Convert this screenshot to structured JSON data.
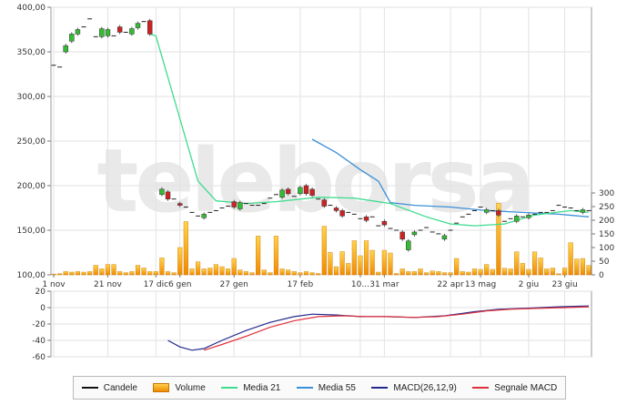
{
  "watermark": "teleborsa",
  "colors": {
    "candle_up": "#33bb33",
    "candle_down": "#cc2222",
    "volume_top": "#ffd24d",
    "volume_bottom": "#f08a00",
    "media21": "#3fdc8e",
    "media55": "#3b8fd6",
    "macd": "#222a8f",
    "signal": "#e0303a"
  },
  "legend": [
    {
      "id": "candele",
      "label": "Candele",
      "color": "#111111",
      "kind": "line"
    },
    {
      "id": "volume",
      "label": "Volume",
      "color": "#f5a100",
      "kind": "box"
    },
    {
      "id": "media21",
      "label": "Media 21",
      "color": "#3fdc8e",
      "kind": "line"
    },
    {
      "id": "media55",
      "label": "Media 55",
      "color": "#3b8fd6",
      "kind": "line"
    },
    {
      "id": "macd",
      "label": "MACD(26,12,9)",
      "color": "#222a8f",
      "kind": "line"
    },
    {
      "id": "signal",
      "label": "Segnale MACD",
      "color": "#e0303a",
      "kind": "line"
    }
  ],
  "chart_data": [
    {
      "type": "candlestick",
      "x_ticks": [
        {
          "i": 0,
          "label": "1 nov"
        },
        {
          "i": 9,
          "label": "21 nov"
        },
        {
          "i": 17,
          "label": "17 dic"
        },
        {
          "i": 21,
          "label": "6 gen"
        },
        {
          "i": 30,
          "label": "27 gen"
        },
        {
          "i": 41,
          "label": "17 feb"
        },
        {
          "i": 51,
          "label": "10..."
        },
        {
          "i": 55,
          "label": "31 mar"
        },
        {
          "i": 66,
          "label": "22 apr"
        },
        {
          "i": 71,
          "label": "13 mag"
        },
        {
          "i": 79,
          "label": "2 giu"
        },
        {
          "i": 85,
          "label": "23 giu"
        }
      ],
      "n": 90,
      "ylim": [
        100,
        400
      ],
      "y_ticks": [
        "100,00",
        "150,00",
        "200,00",
        "250,00",
        "300,00",
        "350,00",
        "400,00"
      ],
      "volume_ylim": [
        0,
        300
      ],
      "volume_ticks": [
        "0",
        "50",
        "100",
        "150",
        "200",
        "250",
        "300"
      ],
      "candles": [
        {
          "i": 0,
          "o": 335,
          "c": 335
        },
        {
          "i": 1,
          "o": 333,
          "c": 333
        },
        {
          "i": 2,
          "o": 350,
          "c": 357
        },
        {
          "i": 3,
          "o": 362,
          "c": 370
        },
        {
          "i": 4,
          "o": 370,
          "c": 375
        },
        {
          "i": 5,
          "o": 378,
          "c": 378
        },
        {
          "i": 6,
          "o": 387,
          "c": 387
        },
        {
          "i": 7,
          "o": 367,
          "c": 367
        },
        {
          "i": 8,
          "o": 367,
          "c": 376
        },
        {
          "i": 9,
          "o": 368,
          "c": 375
        },
        {
          "i": 10,
          "o": 368,
          "c": 368
        },
        {
          "i": 11,
          "o": 378,
          "c": 372
        },
        {
          "i": 12,
          "o": 372,
          "c": 372
        },
        {
          "i": 13,
          "o": 370,
          "c": 376
        },
        {
          "i": 14,
          "o": 377,
          "c": 382
        },
        {
          "i": 15,
          "o": 384,
          "c": 384
        },
        {
          "i": 16,
          "o": 385,
          "c": 370
        },
        {
          "i": 18,
          "o": 190,
          "c": 196
        },
        {
          "i": 19,
          "o": 193,
          "c": 185
        },
        {
          "i": 20,
          "o": 185,
          "c": 185
        },
        {
          "i": 21,
          "o": 180,
          "c": 178
        },
        {
          "i": 22,
          "o": 176,
          "c": 176
        },
        {
          "i": 23,
          "o": 170,
          "c": 170
        },
        {
          "i": 24,
          "o": 166,
          "c": 166
        },
        {
          "i": 25,
          "o": 164,
          "c": 168
        },
        {
          "i": 26,
          "o": 170,
          "c": 170
        },
        {
          "i": 27,
          "o": 172,
          "c": 172
        },
        {
          "i": 28,
          "o": 175,
          "c": 175
        },
        {
          "i": 29,
          "o": 177,
          "c": 177
        },
        {
          "i": 30,
          "o": 182,
          "c": 176
        },
        {
          "i": 31,
          "o": 174,
          "c": 181
        },
        {
          "i": 32,
          "o": 180,
          "c": 180
        },
        {
          "i": 33,
          "o": 178,
          "c": 178
        },
        {
          "i": 34,
          "o": 178,
          "c": 178
        },
        {
          "i": 35,
          "o": 180,
          "c": 180
        },
        {
          "i": 36,
          "o": 186,
          "c": 186
        },
        {
          "i": 37,
          "o": 190,
          "c": 190
        },
        {
          "i": 38,
          "o": 187,
          "c": 195
        },
        {
          "i": 39,
          "o": 196,
          "c": 191
        },
        {
          "i": 40,
          "o": 188,
          "c": 188
        },
        {
          "i": 41,
          "o": 191,
          "c": 198
        },
        {
          "i": 42,
          "o": 200,
          "c": 191
        },
        {
          "i": 43,
          "o": 196,
          "c": 189
        },
        {
          "i": 44,
          "o": 185,
          "c": 185
        },
        {
          "i": 45,
          "o": 184,
          "c": 177
        },
        {
          "i": 46,
          "o": 178,
          "c": 178
        },
        {
          "i": 47,
          "o": 175,
          "c": 172
        },
        {
          "i": 48,
          "o": 172,
          "c": 166
        },
        {
          "i": 49,
          "o": 170,
          "c": 170
        },
        {
          "i": 50,
          "o": 168,
          "c": 168
        },
        {
          "i": 51,
          "o": 163,
          "c": 163
        },
        {
          "i": 52,
          "o": 165,
          "c": 161
        },
        {
          "i": 53,
          "o": 165,
          "c": 165
        },
        {
          "i": 54,
          "o": 155,
          "c": 155
        },
        {
          "i": 55,
          "o": 160,
          "c": 156
        },
        {
          "i": 56,
          "o": 152,
          "c": 152
        },
        {
          "i": 57,
          "o": 150,
          "c": 150
        },
        {
          "i": 58,
          "o": 148,
          "c": 140
        },
        {
          "i": 59,
          "o": 128,
          "c": 138
        },
        {
          "i": 60,
          "o": 145,
          "c": 148
        },
        {
          "i": 61,
          "o": 150,
          "c": 150
        },
        {
          "i": 62,
          "o": 153,
          "c": 153
        },
        {
          "i": 63,
          "o": 148,
          "c": 148
        },
        {
          "i": 64,
          "o": 146,
          "c": 146
        },
        {
          "i": 65,
          "o": 140,
          "c": 144
        },
        {
          "i": 66,
          "o": 150,
          "c": 150
        },
        {
          "i": 67,
          "o": 158,
          "c": 158
        },
        {
          "i": 68,
          "o": 165,
          "c": 165
        },
        {
          "i": 69,
          "o": 168,
          "c": 168
        },
        {
          "i": 70,
          "o": 172,
          "c": 172
        },
        {
          "i": 71,
          "o": 176,
          "c": 176
        },
        {
          "i": 72,
          "o": 170,
          "c": 173
        },
        {
          "i": 73,
          "o": 172,
          "c": 172
        },
        {
          "i": 74,
          "o": 172,
          "c": 167
        },
        {
          "i": 75,
          "o": 160,
          "c": 160
        },
        {
          "i": 76,
          "o": 163,
          "c": 163
        },
        {
          "i": 77,
          "o": 160,
          "c": 166
        },
        {
          "i": 78,
          "o": 165,
          "c": 165
        },
        {
          "i": 79,
          "o": 164,
          "c": 167
        },
        {
          "i": 80,
          "o": 168,
          "c": 168
        },
        {
          "i": 81,
          "o": 170,
          "c": 170
        },
        {
          "i": 82,
          "o": 170,
          "c": 170
        },
        {
          "i": 83,
          "o": 172,
          "c": 172
        },
        {
          "i": 84,
          "o": 178,
          "c": 178
        },
        {
          "i": 85,
          "o": 176,
          "c": 176
        },
        {
          "i": 86,
          "o": 175,
          "c": 175
        },
        {
          "i": 87,
          "o": 172,
          "c": 172
        },
        {
          "i": 88,
          "o": 170,
          "c": 173
        },
        {
          "i": 89,
          "o": 172,
          "c": 172
        }
      ],
      "volume": [
        3,
        4,
        12,
        10,
        12,
        10,
        12,
        35,
        22,
        38,
        38,
        12,
        8,
        12,
        35,
        25,
        12,
        12,
        62,
        12,
        8,
        100,
        195,
        22,
        48,
        22,
        25,
        38,
        30,
        22,
        60,
        18,
        12,
        8,
        142,
        18,
        8,
        142,
        22,
        18,
        12,
        8,
        12,
        8,
        5,
        178,
        82,
        30,
        85,
        42,
        125,
        70,
        125,
        90,
        10,
        90,
        80,
        5,
        22,
        12,
        12,
        22,
        8,
        14,
        12,
        8,
        8,
        60,
        12,
        10,
        22,
        20,
        38,
        20,
        262,
        24,
        22,
        84,
        42,
        20,
        84,
        62,
        22,
        25,
        4,
        25,
        118,
        58,
        60,
        34,
        57,
        58,
        38
      ],
      "media21": [
        {
          "i": 16,
          "y": 370
        },
        {
          "i": 17,
          "y": 368
        },
        {
          "i": 24,
          "y": 205
        },
        {
          "i": 27,
          "y": 183
        },
        {
          "i": 32,
          "y": 180
        },
        {
          "i": 37,
          "y": 182
        },
        {
          "i": 44,
          "y": 187
        },
        {
          "i": 50,
          "y": 186
        },
        {
          "i": 56,
          "y": 180
        },
        {
          "i": 62,
          "y": 165
        },
        {
          "i": 66,
          "y": 157
        },
        {
          "i": 70,
          "y": 155
        },
        {
          "i": 75,
          "y": 157
        },
        {
          "i": 80,
          "y": 167
        },
        {
          "i": 86,
          "y": 172
        },
        {
          "i": 89,
          "y": 170
        }
      ],
      "media55": [
        {
          "i": 43,
          "y": 252
        },
        {
          "i": 47,
          "y": 237
        },
        {
          "i": 51,
          "y": 218
        },
        {
          "i": 54,
          "y": 205
        },
        {
          "i": 56,
          "y": 181
        },
        {
          "i": 60,
          "y": 178
        },
        {
          "i": 66,
          "y": 176
        },
        {
          "i": 72,
          "y": 172
        },
        {
          "i": 78,
          "y": 170
        },
        {
          "i": 84,
          "y": 168
        },
        {
          "i": 89,
          "y": 165
        }
      ]
    },
    {
      "type": "line",
      "ylim": [
        -60,
        20
      ],
      "y_ticks": [
        "20",
        "0",
        "-20",
        "-40",
        "-60"
      ],
      "series": [
        {
          "name": "MACD(26,12,9)",
          "points": [
            {
              "i": 19,
              "y": -40
            },
            {
              "i": 21,
              "y": -48
            },
            {
              "i": 23,
              "y": -52
            },
            {
              "i": 25,
              "y": -50
            },
            {
              "i": 28,
              "y": -40
            },
            {
              "i": 32,
              "y": -28
            },
            {
              "i": 36,
              "y": -18
            },
            {
              "i": 40,
              "y": -11
            },
            {
              "i": 43,
              "y": -8
            },
            {
              "i": 47,
              "y": -9
            },
            {
              "i": 51,
              "y": -11
            },
            {
              "i": 55,
              "y": -11
            },
            {
              "i": 60,
              "y": -12
            },
            {
              "i": 65,
              "y": -10
            },
            {
              "i": 70,
              "y": -5
            },
            {
              "i": 74,
              "y": -2
            },
            {
              "i": 78,
              "y": -1
            },
            {
              "i": 84,
              "y": 1
            },
            {
              "i": 89,
              "y": 2
            }
          ]
        },
        {
          "name": "Segnale MACD",
          "points": [
            {
              "i": 25,
              "y": -52
            },
            {
              "i": 28,
              "y": -45
            },
            {
              "i": 32,
              "y": -35
            },
            {
              "i": 36,
              "y": -24
            },
            {
              "i": 40,
              "y": -16
            },
            {
              "i": 44,
              "y": -11
            },
            {
              "i": 48,
              "y": -10
            },
            {
              "i": 52,
              "y": -11
            },
            {
              "i": 56,
              "y": -11
            },
            {
              "i": 60,
              "y": -12
            },
            {
              "i": 64,
              "y": -11
            },
            {
              "i": 68,
              "y": -8
            },
            {
              "i": 72,
              "y": -4
            },
            {
              "i": 76,
              "y": -2
            },
            {
              "i": 80,
              "y": -1
            },
            {
              "i": 85,
              "y": 0
            },
            {
              "i": 89,
              "y": 1
            }
          ]
        }
      ]
    }
  ]
}
